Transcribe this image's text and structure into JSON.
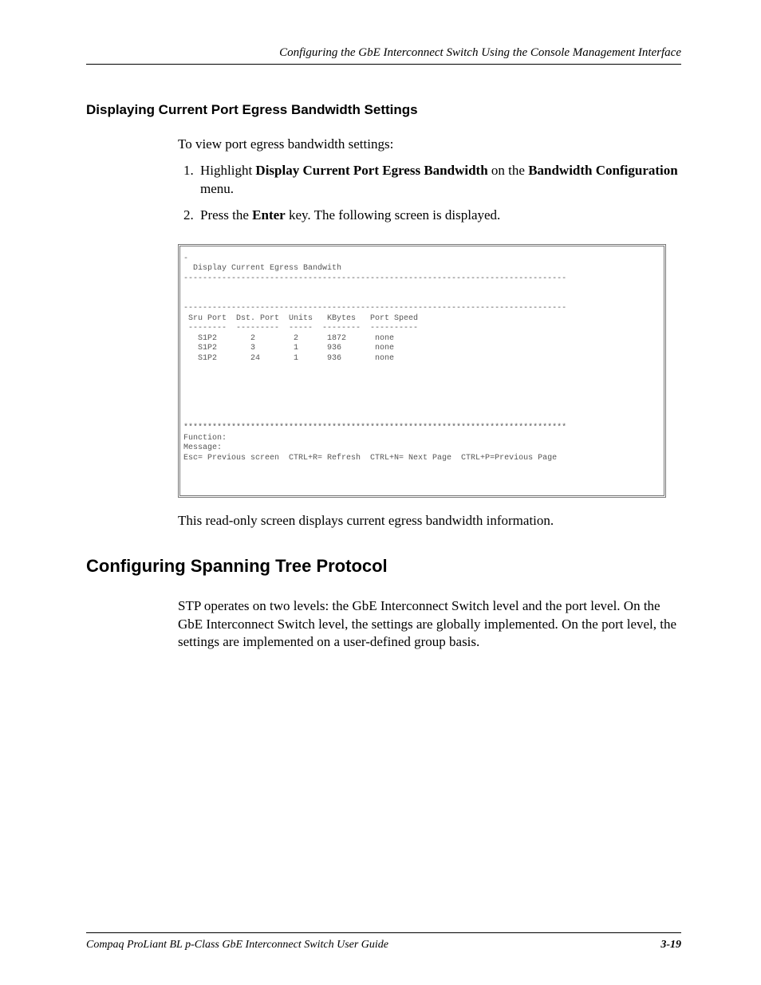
{
  "header": {
    "chapter_title": "Configuring the GbE Interconnect Switch Using the Console Management Interface"
  },
  "section1": {
    "title": "Displaying Current Port Egress Bandwidth Settings",
    "intro": "To view port egress bandwidth settings:",
    "step1_pre": "Highlight ",
    "step1_bold1": "Display Current Port Egress Bandwidth",
    "step1_mid": " on the ",
    "step1_bold2": "Bandwidth Configuration",
    "step1_post": " menu.",
    "step2_pre": "Press the ",
    "step2_bold": "Enter",
    "step2_post": " key. The following screen is displayed.",
    "after_shot": "This read-only screen displays current egress bandwidth information."
  },
  "console": {
    "title": "Display Current Egress Bandwith",
    "hr": "--------------------------------------------------------------------------------",
    "hdr": " Sru Port  Dst. Port  Units   KBytes   Port Speed",
    "sep": " --------  ---------  -----  --------  ----------",
    "rows": [
      "   S1P2       2        2      1872      none",
      "   S1P2       3        1      936       none",
      "   S1P2       24       1      936       none"
    ],
    "stars": "********************************************************************************",
    "func": "Function:",
    "msg": "Message:",
    "help": "Esc= Previous screen  CTRL+R= Refresh  CTRL+N= Next Page  CTRL+P=Previous Page"
  },
  "section2": {
    "title": "Configuring Spanning Tree Protocol",
    "para": "STP operates on two levels: the GbE Interconnect Switch level and the port level. On the GbE Interconnect Switch level, the settings are globally implemented. On the port level, the settings are implemented on a user-defined group basis."
  },
  "footer": {
    "book": "Compaq ProLiant BL p-Class GbE Interconnect Switch User Guide",
    "page": "3-19"
  }
}
